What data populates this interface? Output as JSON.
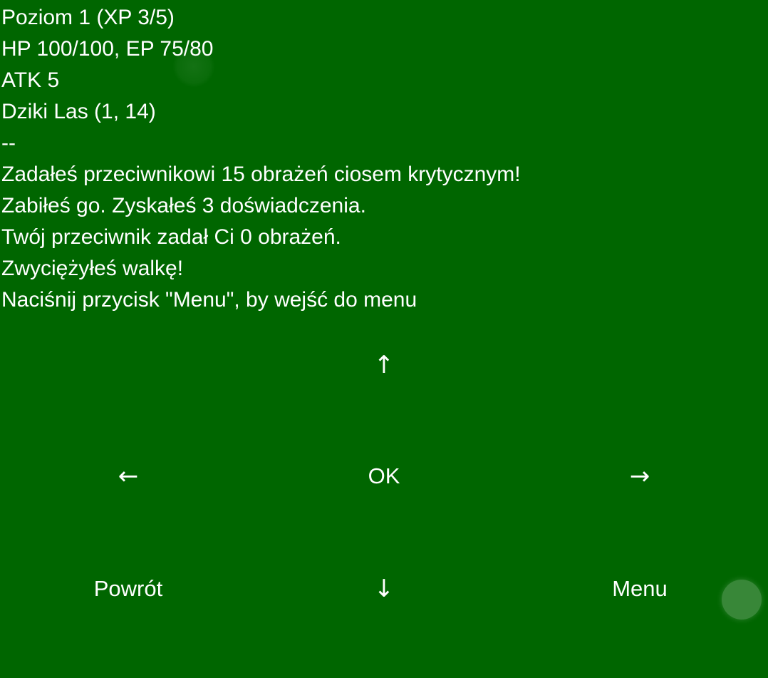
{
  "status": {
    "level_line": "Poziom 1 (XP 3/5)",
    "hp_ep_line": "HP 100/100, EP 75/80",
    "atk_line": "ATK 5",
    "location_line": "Dziki Las (1, 14)",
    "separator": "--"
  },
  "messages": [
    "Zadałeś przeciwnikowi 15 obrażeń ciosem krytycznym!",
    "Zabiłeś go. Zyskałeś 3 doświadczenia.",
    "Twój przeciwnik zadał Ci 0 obrażeń.",
    "Zwyciężyłeś walkę!",
    "Naciśnij przycisk \"Menu\", by wejść do menu"
  ],
  "controls": {
    "up": "↑",
    "left": "←",
    "ok": "OK",
    "right": "→",
    "back": "Powrót",
    "down": "↓",
    "menu": "Menu"
  },
  "colors": {
    "background": "#006600",
    "text": "#ffffff"
  }
}
